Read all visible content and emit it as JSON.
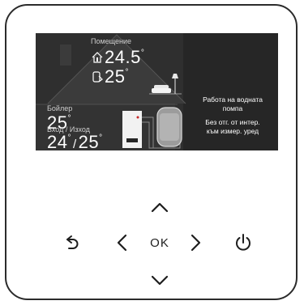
{
  "screen": {
    "room": {
      "label": "Помещение",
      "temp_current": "24.5",
      "temp_set": "25",
      "deg": "°"
    },
    "boiler": {
      "label": "Бойлер",
      "temp": "25",
      "deg": "°"
    },
    "flow": {
      "label": "Вход / Изход",
      "inlet": "24",
      "sep": "/",
      "outlet": "25",
      "deg": "°"
    },
    "status": {
      "line1": "Работа на водната",
      "line2": "помпа",
      "line3": "Без отг. от интер.",
      "line4": "към измер. уред"
    }
  },
  "controls": {
    "ok_label": "OK",
    "up": "chevron-up-icon",
    "down": "chevron-down-icon",
    "left": "chevron-left-icon",
    "right": "chevron-right-icon",
    "back": "back-arrow-icon",
    "power": "power-icon"
  },
  "colors": {
    "screen_bg": "#262626",
    "house_fill": "#3a3a3a",
    "text": "#ffffff",
    "bezel": "#2b2b2b"
  }
}
